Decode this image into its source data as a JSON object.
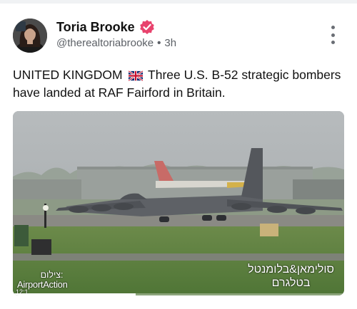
{
  "author": {
    "display_name": "Toria Brooke",
    "handle": "@therealtoriabrooke",
    "separator": "•",
    "time_ago": "3h",
    "verified": true,
    "verified_color": "#e8436d"
  },
  "menu": {
    "icon": "more-vertical-icon"
  },
  "post": {
    "text_before_flag": "UNITED KINGDOM",
    "flag_icon": "uk-flag-icon",
    "text_after_flag": "Three U.S. B-52 strategic bombers have landed at RAF Fairford in Britain."
  },
  "media": {
    "type": "video",
    "credit_label": "צילום:",
    "credit_brand": "AirportAction",
    "channel_mark_line1": "סולימאן&בלומנטל",
    "channel_mark_line2": "בטלגרם",
    "timestamp": "12:1",
    "progress": 0.37
  },
  "colors": {
    "text_primary": "#111111",
    "text_secondary": "#5c6066"
  }
}
